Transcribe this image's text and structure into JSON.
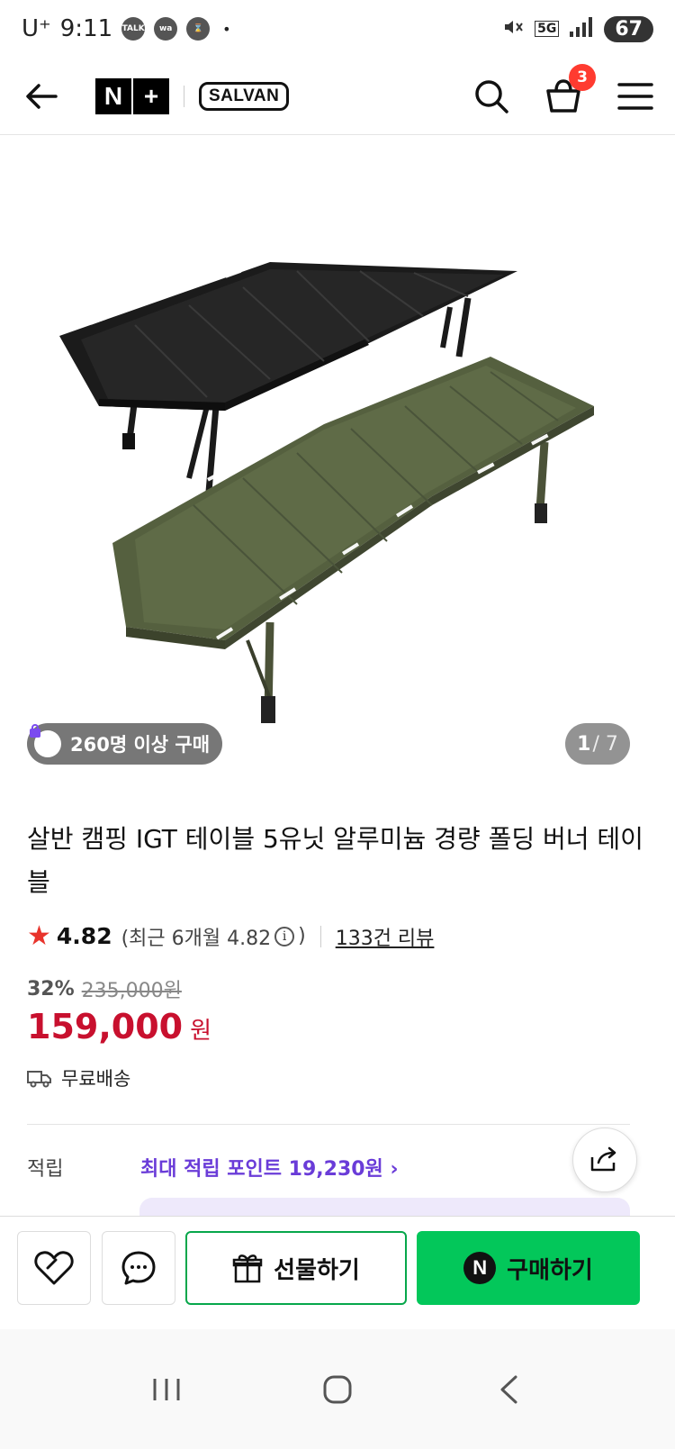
{
  "status_bar": {
    "carrier": "U⁺",
    "time": "9:11",
    "notif_1": "TALK",
    "notif_2": "wa",
    "dot": "•",
    "network": "5G",
    "battery": "67"
  },
  "header": {
    "logo_n": "N",
    "logo_plus": "+",
    "brand": "SALVAN",
    "cart_count": "3"
  },
  "hero": {
    "buyers_badge": "260명 이상 구매",
    "pager_current": "1",
    "pager_total": "/ 7"
  },
  "product": {
    "title": "살반 캠핑 IGT 테이블 5유닛 알루미늄 경량 폴딩 버너 테이블",
    "rating": "4.82",
    "recent_prefix": "(최근 6개월 4.82",
    "recent_suffix": ")",
    "info_glyph": "i",
    "reviews": "133건 리뷰",
    "discount": "32%",
    "original_price": "235,000원",
    "price": "159,000",
    "currency": "원",
    "shipping": "무료배송",
    "points_label": "적립",
    "points_value": "최대 적립 포인트 19,230원 ›"
  },
  "actions": {
    "gift_label": "선물하기",
    "buy_label": "구매하기",
    "buy_badge": "N"
  },
  "icons": {
    "back": "arrow-left-icon",
    "search": "search-icon",
    "cart": "shopping-basket-icon",
    "menu": "hamburger-icon",
    "share": "share-icon",
    "wishlist": "heart-icon",
    "chat": "chat-bubble-icon",
    "gift": "gift-icon",
    "shipping": "truck-icon",
    "star": "star-icon"
  },
  "colors": {
    "price_red": "#c8102e",
    "points_purple": "#6a3cd8",
    "naver_green": "#03c75a",
    "star_red": "#e8342c"
  }
}
